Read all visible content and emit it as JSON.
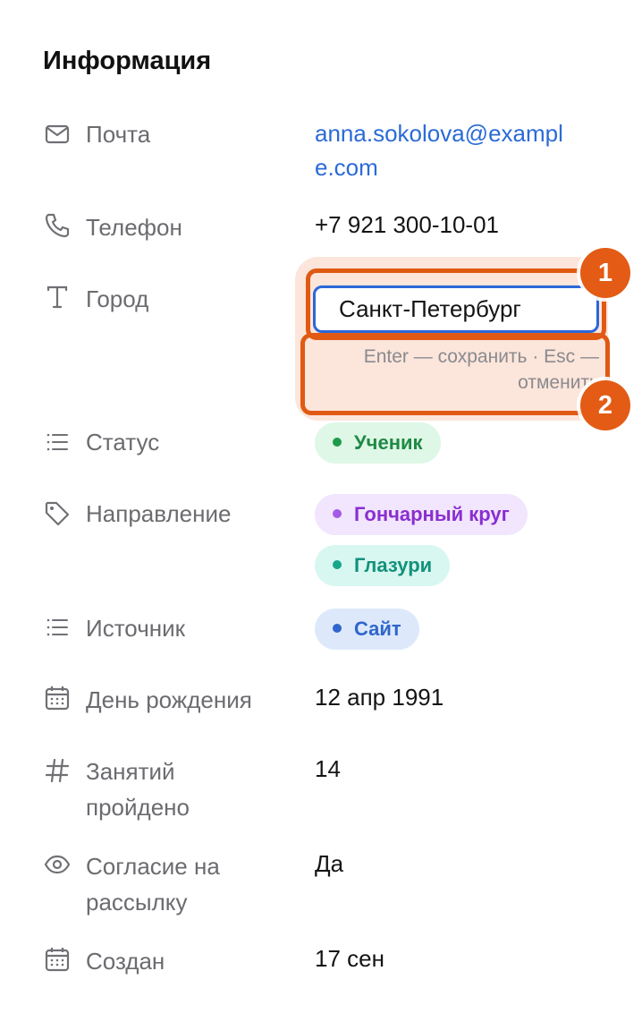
{
  "section": {
    "title": "Информация"
  },
  "fields": {
    "email": {
      "label": "Почта",
      "value": "anna.sokolova@example.com",
      "icon": "mail-icon"
    },
    "phone": {
      "label": "Телефон",
      "value": "+7 921 300-10-01",
      "icon": "phone-icon"
    },
    "city": {
      "label": "Город",
      "value": "Санкт-Петербург",
      "hint": "Enter — сохранить · Esc — отменить",
      "icon": "text-icon"
    },
    "status": {
      "label": "Статус",
      "tags": [
        {
          "text": "Ученик",
          "color": "#1f9a4c"
        }
      ],
      "icon": "list-icon"
    },
    "direction": {
      "label": "Направление",
      "tags": [
        {
          "text": "Гончарный круг",
          "color": "#a55ae6"
        },
        {
          "text": "Глазури",
          "color": "#17a68c"
        }
      ],
      "icon": "tag-icon"
    },
    "source": {
      "label": "Источник",
      "tags": [
        {
          "text": "Сайт",
          "color": "#2f66cc"
        }
      ],
      "icon": "list-icon"
    },
    "birthday": {
      "label": "День рождения",
      "value": "12 апр 1991",
      "icon": "calendar-icon"
    },
    "lessons": {
      "label": "Занятий пройдено",
      "value": "14",
      "icon": "hash-icon"
    },
    "consent": {
      "label": "Согласие на рассылку",
      "value": "Да",
      "icon": "eye-icon"
    },
    "created": {
      "label": "Создан",
      "value": "17 сен",
      "icon": "calendar-icon"
    }
  },
  "annotations": {
    "badge_1": "1",
    "badge_2": "2",
    "accent_color": "#e35b14"
  }
}
